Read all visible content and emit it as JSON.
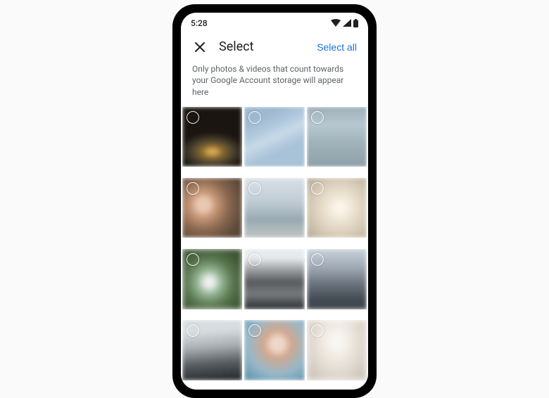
{
  "status": {
    "time": "5:28"
  },
  "header": {
    "title": "Select",
    "select_all_label": "Select all"
  },
  "info": "Only photos & videos that count towards your Google Account storage will appear here",
  "photos": [
    {
      "selected": false
    },
    {
      "selected": false
    },
    {
      "selected": false
    },
    {
      "selected": false
    },
    {
      "selected": false
    },
    {
      "selected": false
    },
    {
      "selected": false
    },
    {
      "selected": false
    },
    {
      "selected": false
    },
    {
      "selected": false
    },
    {
      "selected": false
    },
    {
      "selected": false
    }
  ]
}
